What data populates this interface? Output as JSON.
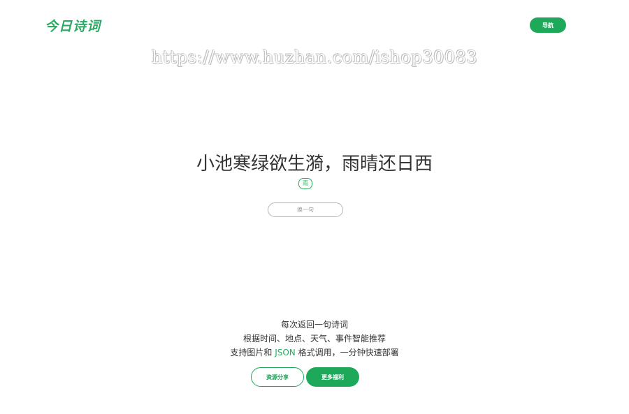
{
  "header": {
    "logo_text": "今日诗词",
    "nav_label": "导航"
  },
  "watermark": {
    "text": "https://www.huzhan.com/ishop30083"
  },
  "poem": {
    "line": "小池寒绿欲生漪，雨晴还日西",
    "tag": "雨",
    "refresh_label": "换一句"
  },
  "features": {
    "line1": "每次返回一句诗词",
    "line2": "根据时间、地点、天气、事件智能推荐",
    "line3_before": "支持图片和 ",
    "line3_json": "JSON",
    "line3_after": " 格式调用，一分钟快速部署"
  },
  "actions": {
    "resource_label": "资源分享",
    "more_label": "更多福利"
  },
  "colors": {
    "accent": "#1ea85a",
    "text": "#333333",
    "muted": "#999999"
  }
}
